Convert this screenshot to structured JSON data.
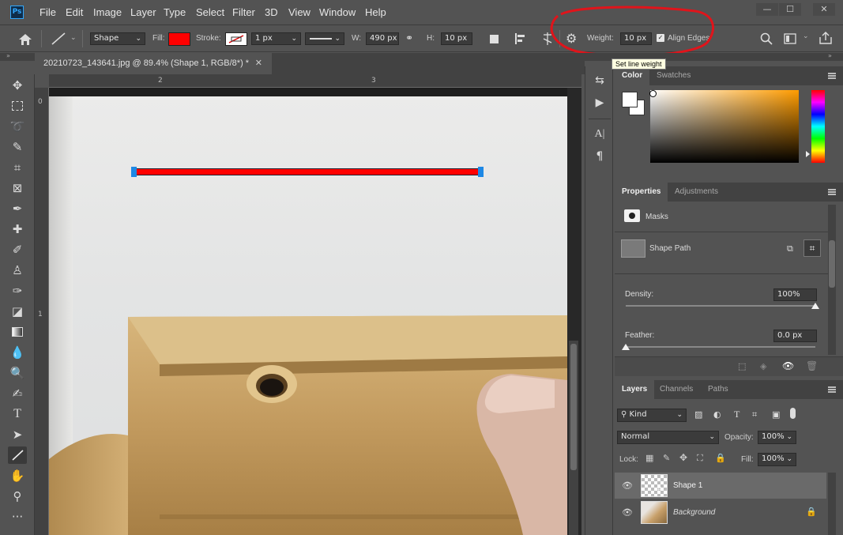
{
  "app": {
    "logo": "Ps",
    "menu": [
      "File",
      "Edit",
      "Image",
      "Layer",
      "Type",
      "Select",
      "Filter",
      "3D",
      "View",
      "Window",
      "Help"
    ],
    "window_buttons": [
      "—",
      "☐",
      "✕"
    ]
  },
  "options": {
    "mode": "Shape",
    "fill_label": "Fill:",
    "fill_color": "#ff0000",
    "stroke_label": "Stroke:",
    "stroke_width": "1 px",
    "w_label": "W:",
    "w_value": "490 px",
    "h_label": "H:",
    "h_value": "10 px",
    "weight_label": "Weight:",
    "weight_value": "10 px",
    "align_edges": "Align Edges",
    "tooltip": "Set line weight",
    "annotation_color": "#e0141b"
  },
  "document": {
    "tab_title": "20210723_143641.jpg @ 89.4% (Shape 1, RGB/8*) *",
    "ruler_top": [
      "2",
      "3"
    ],
    "ruler_left": [
      "0",
      "1"
    ],
    "line_color": "#ff0000"
  },
  "color_panel": {
    "tabs": [
      "Color",
      "Swatches"
    ]
  },
  "properties": {
    "tabs": [
      "Properties",
      "Adjustments"
    ],
    "masks_label": "Masks",
    "shape_path_label": "Shape Path",
    "density_label": "Density:",
    "density_value": "100%",
    "density_level": 1.0,
    "feather_label": "Feather:",
    "feather_value": "0.0 px",
    "feather_level": 0.0
  },
  "layers": {
    "tabs": [
      "Layers",
      "Channels",
      "Paths"
    ],
    "filter": "Kind",
    "blend_mode": "Normal",
    "opacity_label": "Opacity:",
    "opacity_value": "100%",
    "lock_label": "Lock:",
    "fill_label": "Fill:",
    "fill_value": "100%",
    "items": [
      {
        "name": "Shape 1"
      },
      {
        "name": "Background"
      }
    ]
  }
}
